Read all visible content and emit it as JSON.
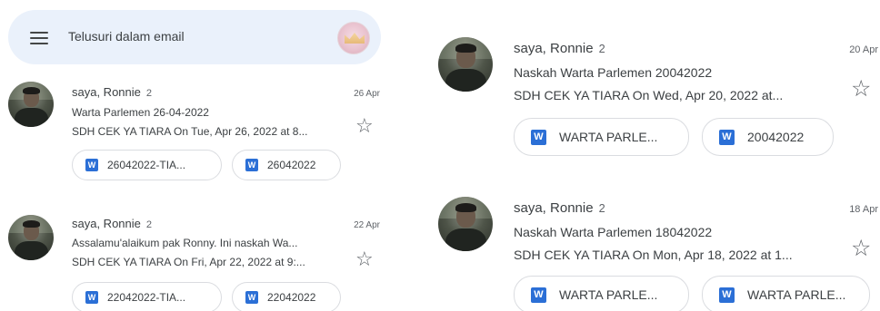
{
  "search": {
    "placeholder": "Telusuri dalam email"
  },
  "icons": {
    "menu": "menu-icon",
    "star": "star-outline-icon",
    "attachment": "word-doc-icon",
    "accent_word": "#2b6fd6"
  },
  "emails": [
    {
      "sender": "saya, Ronnie",
      "count": "2",
      "date": "26 Apr",
      "subject": "Warta Parlemen 26-04-2022",
      "snippet": "SDH CEK YA TIARA On Tue, Apr 26, 2022 at 8...",
      "attachments": [
        {
          "icon": "W",
          "name": "26042022-TIA..."
        },
        {
          "icon": "W",
          "name": "26042022"
        }
      ]
    },
    {
      "sender": "saya, Ronnie",
      "count": "2",
      "date": "22 Apr",
      "subject": "Assalamu'alaikum pak Ronny. Ini naskah Wa...",
      "snippet": "SDH CEK YA TIARA On Fri, Apr 22, 2022 at 9:...",
      "attachments": [
        {
          "icon": "W",
          "name": "22042022-TIA..."
        },
        {
          "icon": "W",
          "name": "22042022"
        }
      ]
    },
    {
      "sender": "saya, Ronnie",
      "count": "2",
      "date": "20 Apr",
      "subject": "Naskah Warta Parlemen 20042022",
      "snippet": "SDH CEK YA TIARA On Wed, Apr 20, 2022 at...",
      "attachments": [
        {
          "icon": "W",
          "name": "WARTA PARLE..."
        },
        {
          "icon": "W",
          "name": "20042022"
        }
      ]
    },
    {
      "sender": "saya, Ronnie",
      "count": "2",
      "date": "18 Apr",
      "subject": "Naskah Warta Parlemen 18042022",
      "snippet": "SDH CEK YA TIARA On Mon, Apr 18, 2022 at 1...",
      "attachments": [
        {
          "icon": "W",
          "name": "WARTA PARLE..."
        },
        {
          "icon": "W",
          "name": "WARTA PARLE..."
        }
      ]
    }
  ]
}
